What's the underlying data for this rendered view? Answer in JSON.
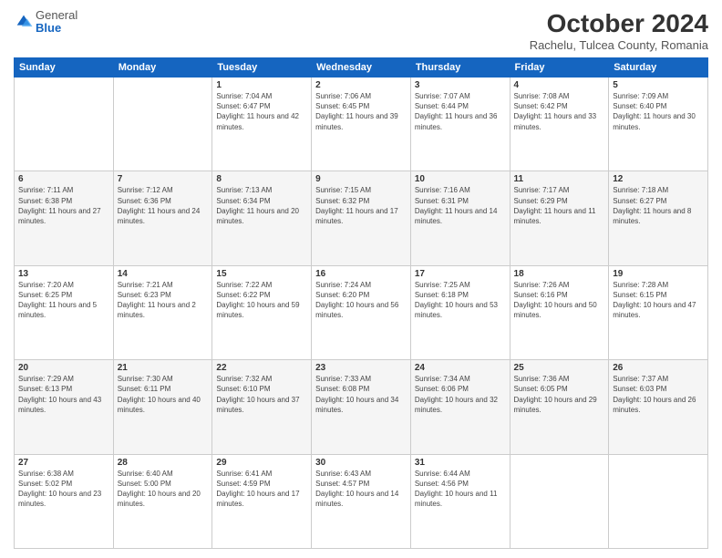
{
  "logo": {
    "general": "General",
    "blue": "Blue"
  },
  "header": {
    "title": "October 2024",
    "subtitle": "Rachelu, Tulcea County, Romania"
  },
  "weekdays": [
    "Sunday",
    "Monday",
    "Tuesday",
    "Wednesday",
    "Thursday",
    "Friday",
    "Saturday"
  ],
  "weeks": [
    [
      {
        "day": "",
        "info": ""
      },
      {
        "day": "",
        "info": ""
      },
      {
        "day": "1",
        "info": "Sunrise: 7:04 AM\nSunset: 6:47 PM\nDaylight: 11 hours and 42 minutes."
      },
      {
        "day": "2",
        "info": "Sunrise: 7:06 AM\nSunset: 6:45 PM\nDaylight: 11 hours and 39 minutes."
      },
      {
        "day": "3",
        "info": "Sunrise: 7:07 AM\nSunset: 6:44 PM\nDaylight: 11 hours and 36 minutes."
      },
      {
        "day": "4",
        "info": "Sunrise: 7:08 AM\nSunset: 6:42 PM\nDaylight: 11 hours and 33 minutes."
      },
      {
        "day": "5",
        "info": "Sunrise: 7:09 AM\nSunset: 6:40 PM\nDaylight: 11 hours and 30 minutes."
      }
    ],
    [
      {
        "day": "6",
        "info": "Sunrise: 7:11 AM\nSunset: 6:38 PM\nDaylight: 11 hours and 27 minutes."
      },
      {
        "day": "7",
        "info": "Sunrise: 7:12 AM\nSunset: 6:36 PM\nDaylight: 11 hours and 24 minutes."
      },
      {
        "day": "8",
        "info": "Sunrise: 7:13 AM\nSunset: 6:34 PM\nDaylight: 11 hours and 20 minutes."
      },
      {
        "day": "9",
        "info": "Sunrise: 7:15 AM\nSunset: 6:32 PM\nDaylight: 11 hours and 17 minutes."
      },
      {
        "day": "10",
        "info": "Sunrise: 7:16 AM\nSunset: 6:31 PM\nDaylight: 11 hours and 14 minutes."
      },
      {
        "day": "11",
        "info": "Sunrise: 7:17 AM\nSunset: 6:29 PM\nDaylight: 11 hours and 11 minutes."
      },
      {
        "day": "12",
        "info": "Sunrise: 7:18 AM\nSunset: 6:27 PM\nDaylight: 11 hours and 8 minutes."
      }
    ],
    [
      {
        "day": "13",
        "info": "Sunrise: 7:20 AM\nSunset: 6:25 PM\nDaylight: 11 hours and 5 minutes."
      },
      {
        "day": "14",
        "info": "Sunrise: 7:21 AM\nSunset: 6:23 PM\nDaylight: 11 hours and 2 minutes."
      },
      {
        "day": "15",
        "info": "Sunrise: 7:22 AM\nSunset: 6:22 PM\nDaylight: 10 hours and 59 minutes."
      },
      {
        "day": "16",
        "info": "Sunrise: 7:24 AM\nSunset: 6:20 PM\nDaylight: 10 hours and 56 minutes."
      },
      {
        "day": "17",
        "info": "Sunrise: 7:25 AM\nSunset: 6:18 PM\nDaylight: 10 hours and 53 minutes."
      },
      {
        "day": "18",
        "info": "Sunrise: 7:26 AM\nSunset: 6:16 PM\nDaylight: 10 hours and 50 minutes."
      },
      {
        "day": "19",
        "info": "Sunrise: 7:28 AM\nSunset: 6:15 PM\nDaylight: 10 hours and 47 minutes."
      }
    ],
    [
      {
        "day": "20",
        "info": "Sunrise: 7:29 AM\nSunset: 6:13 PM\nDaylight: 10 hours and 43 minutes."
      },
      {
        "day": "21",
        "info": "Sunrise: 7:30 AM\nSunset: 6:11 PM\nDaylight: 10 hours and 40 minutes."
      },
      {
        "day": "22",
        "info": "Sunrise: 7:32 AM\nSunset: 6:10 PM\nDaylight: 10 hours and 37 minutes."
      },
      {
        "day": "23",
        "info": "Sunrise: 7:33 AM\nSunset: 6:08 PM\nDaylight: 10 hours and 34 minutes."
      },
      {
        "day": "24",
        "info": "Sunrise: 7:34 AM\nSunset: 6:06 PM\nDaylight: 10 hours and 32 minutes."
      },
      {
        "day": "25",
        "info": "Sunrise: 7:36 AM\nSunset: 6:05 PM\nDaylight: 10 hours and 29 minutes."
      },
      {
        "day": "26",
        "info": "Sunrise: 7:37 AM\nSunset: 6:03 PM\nDaylight: 10 hours and 26 minutes."
      }
    ],
    [
      {
        "day": "27",
        "info": "Sunrise: 6:38 AM\nSunset: 5:02 PM\nDaylight: 10 hours and 23 minutes."
      },
      {
        "day": "28",
        "info": "Sunrise: 6:40 AM\nSunset: 5:00 PM\nDaylight: 10 hours and 20 minutes."
      },
      {
        "day": "29",
        "info": "Sunrise: 6:41 AM\nSunset: 4:59 PM\nDaylight: 10 hours and 17 minutes."
      },
      {
        "day": "30",
        "info": "Sunrise: 6:43 AM\nSunset: 4:57 PM\nDaylight: 10 hours and 14 minutes."
      },
      {
        "day": "31",
        "info": "Sunrise: 6:44 AM\nSunset: 4:56 PM\nDaylight: 10 hours and 11 minutes."
      },
      {
        "day": "",
        "info": ""
      },
      {
        "day": "",
        "info": ""
      }
    ]
  ]
}
